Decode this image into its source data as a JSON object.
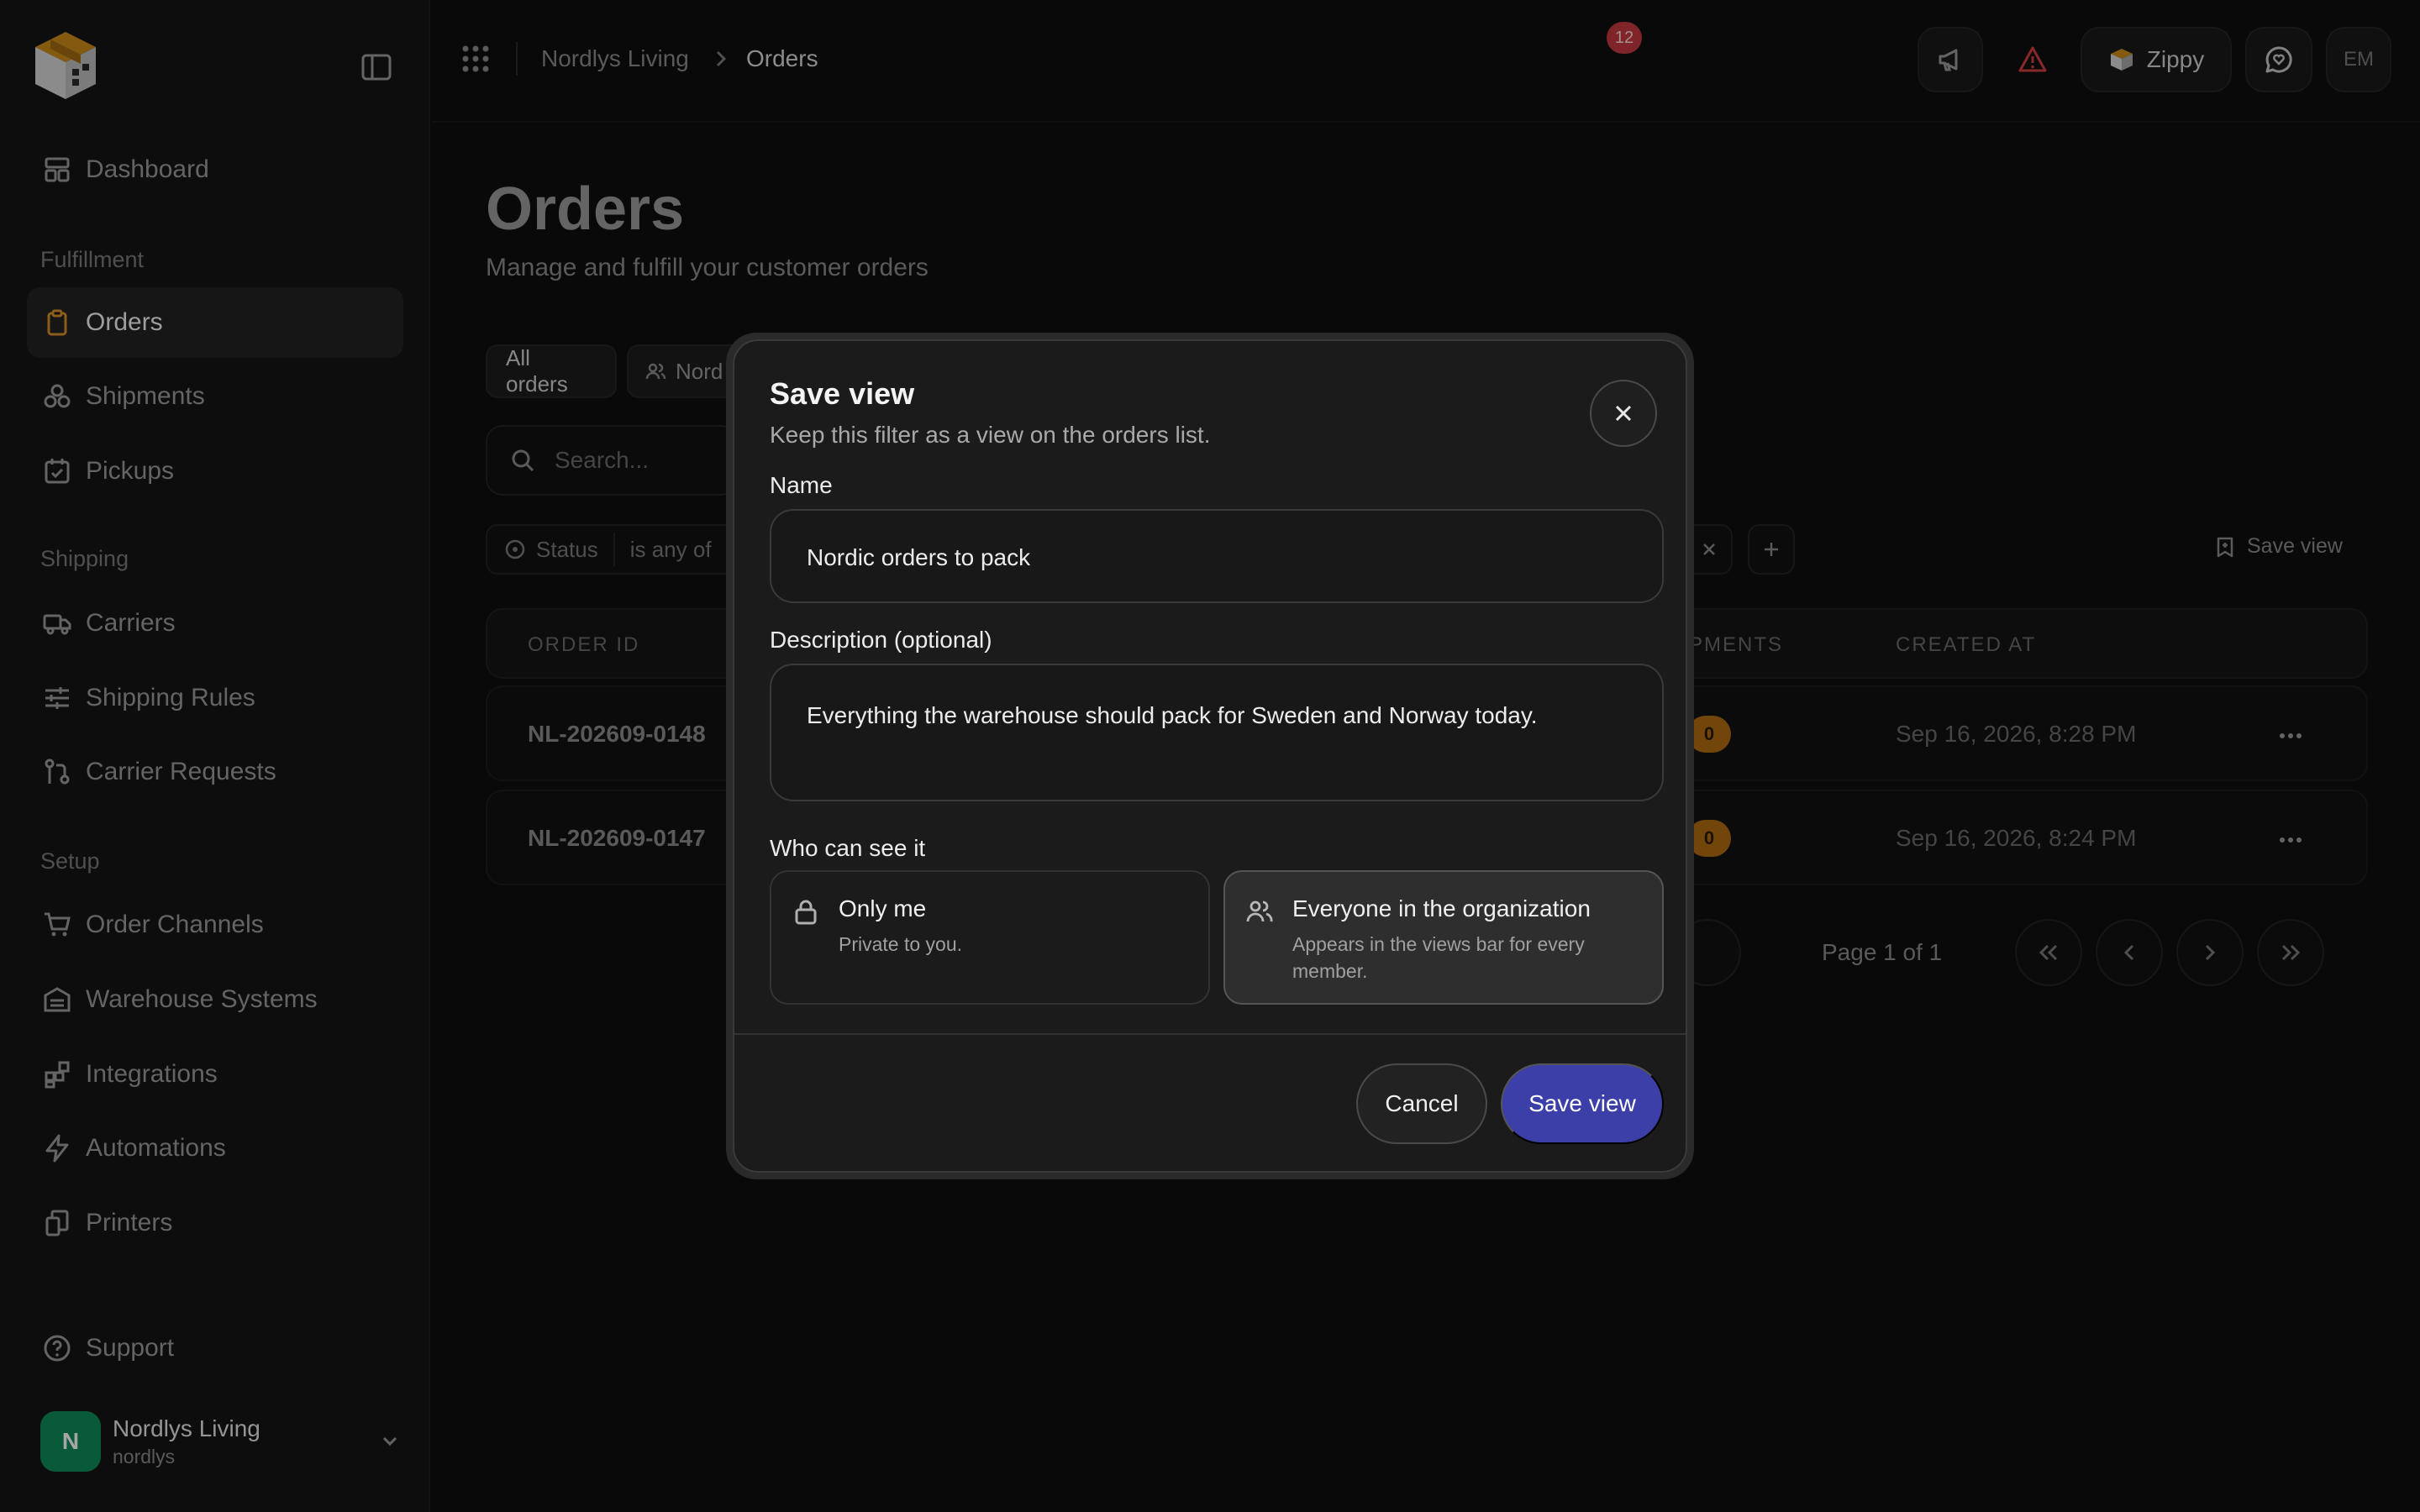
{
  "app": {
    "collapse_icon": "sidebar-toggle-icon"
  },
  "sidebar": {
    "dashboard": "Dashboard",
    "sections": {
      "fulfillment": "Fulfillment",
      "shipping": "Shipping",
      "setup": "Setup"
    },
    "items": {
      "orders": "Orders",
      "shipments": "Shipments",
      "pickups": "Pickups",
      "carriers": "Carriers",
      "shipping_rules": "Shipping Rules",
      "carrier_requests": "Carrier Requests",
      "order_channels": "Order Channels",
      "warehouse_systems": "Warehouse Systems",
      "integrations": "Integrations",
      "automations": "Automations",
      "printers": "Printers"
    },
    "support": "Support",
    "org": {
      "initial": "N",
      "name": "Nordlys Living",
      "slug": "nordlys",
      "avatar_color": "#0f8a57"
    }
  },
  "topbar": {
    "breadcrumb": [
      "Nordlys Living",
      "Orders"
    ],
    "alert_count": "12",
    "zippy_label": "Zippy",
    "user_initials": "EM"
  },
  "page": {
    "title": "Orders",
    "subtitle": "Manage and fulfill your customer orders",
    "view_tabs": [
      "All orders",
      "Nord"
    ],
    "search_placeholder": "Search...",
    "filter": {
      "field": "Status",
      "operator": "is any of"
    },
    "save_view_link": "Save view",
    "table": {
      "columns": {
        "order_id": "ORDER ID",
        "shipments": "PMENTS",
        "created_at": "CREATED AT"
      },
      "rows": [
        {
          "order_id": "NL-202609-0148",
          "shipments": "0",
          "created_at": "Sep 16, 2026, 8:28 PM"
        },
        {
          "order_id": "NL-202609-0147",
          "shipments": "0",
          "created_at": "Sep 16, 2026, 8:24 PM"
        }
      ]
    },
    "pagination": {
      "page_info": "Page 1 of 1"
    }
  },
  "modal": {
    "title": "Save view",
    "subtitle": "Keep this filter as a view on the orders list.",
    "name_label": "Name",
    "name_value": "Nordic orders to pack",
    "description_label": "Description (optional)",
    "description_value": "Everything the warehouse should pack for Sweden and Norway today.",
    "visibility_label": "Who can see it",
    "visibility_options": [
      {
        "title": "Only me",
        "description": "Private to you.",
        "selected": false,
        "icon": "lock-icon"
      },
      {
        "title": "Everyone in the organization",
        "description": "Appears in the views bar for every member.",
        "selected": true,
        "icon": "users-icon"
      }
    ],
    "cancel_label": "Cancel",
    "save_label": "Save view",
    "accent_color": "#3d3fa8"
  }
}
